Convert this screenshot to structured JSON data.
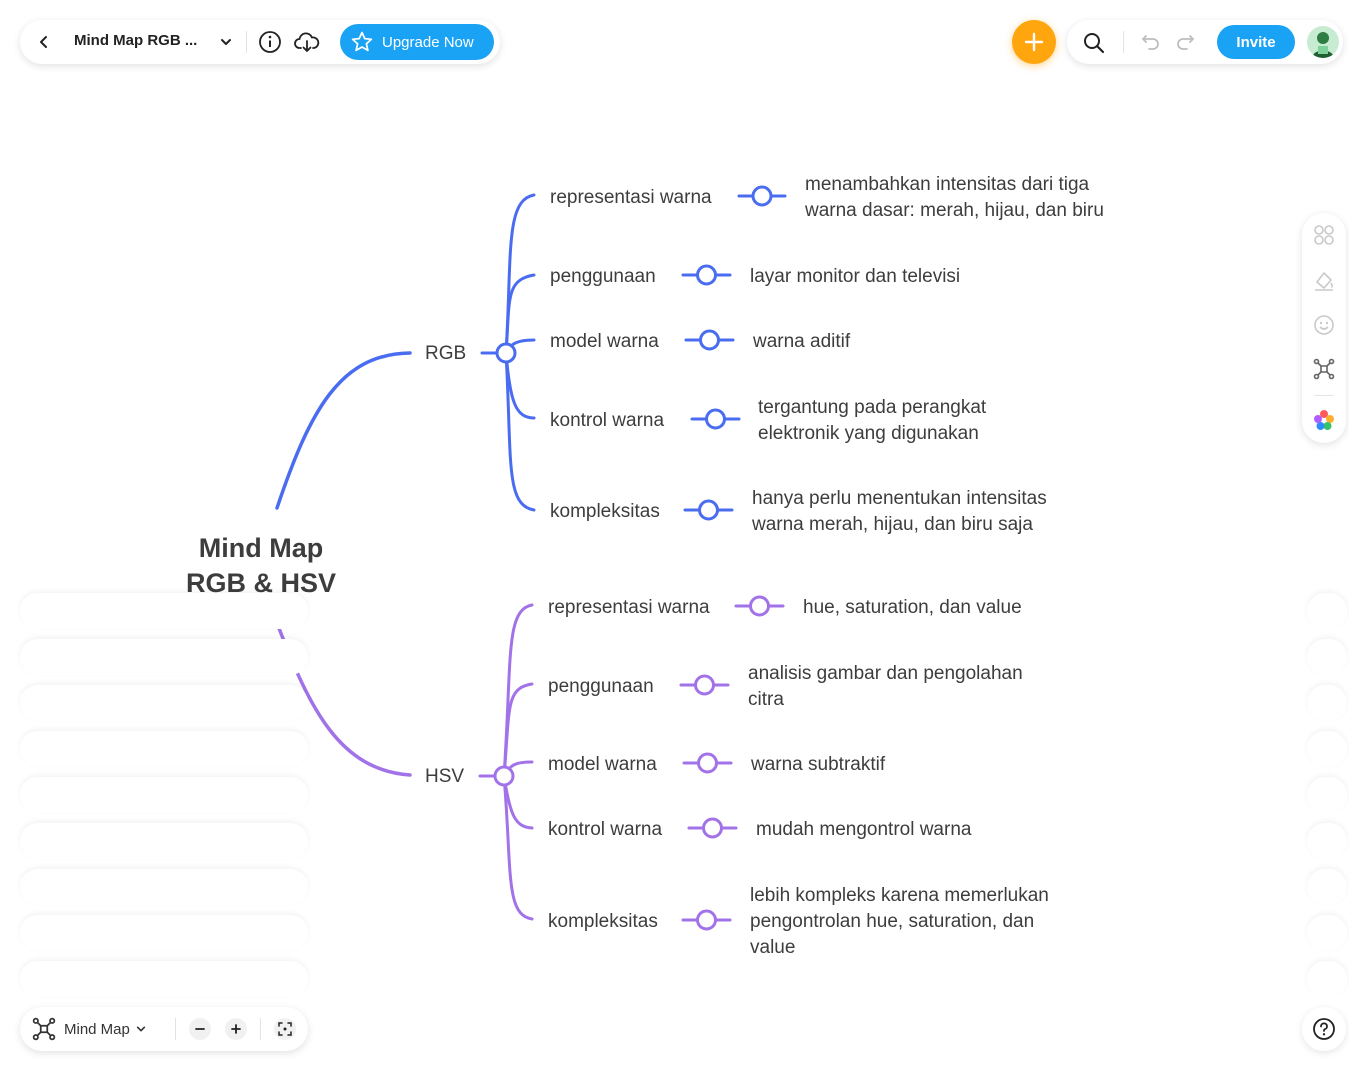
{
  "toolbar": {
    "doc_title": "Mind Map RGB ...",
    "upgrade_label": "Upgrade Now",
    "invite_label": "Invite"
  },
  "bottombar": {
    "view_label": "Mind Map"
  },
  "colors": {
    "rgb_branch": "#4a6cf0",
    "hsv_branch": "#a272e8",
    "accent": "#1aa3f5",
    "add_button": "#ffa50d"
  },
  "mindmap": {
    "root": {
      "line1": "Mind Map",
      "line2": "RGB & HSV"
    },
    "rgb": {
      "label": "RGB",
      "children": [
        {
          "label": "representasi warna",
          "detail": [
            "menambahkan intensitas dari tiga",
            "warna dasar: merah, hijau, dan biru"
          ]
        },
        {
          "label": "penggunaan",
          "detail": [
            "layar monitor dan televisi"
          ]
        },
        {
          "label": "model warna",
          "detail": [
            "warna aditif"
          ]
        },
        {
          "label": "kontrol warna",
          "detail": [
            "tergantung pada perangkat",
            "elektronik yang digunakan"
          ]
        },
        {
          "label": "kompleksitas",
          "detail": [
            "hanya perlu menentukan intensitas",
            "warna merah, hijau, dan biru saja"
          ]
        }
      ]
    },
    "hsv": {
      "label": "HSV",
      "children": [
        {
          "label": "representasi warna",
          "detail": [
            "hue, saturation, dan value"
          ]
        },
        {
          "label": "penggunaan",
          "detail": [
            "analisis gambar dan pengolahan",
            "citra"
          ]
        },
        {
          "label": "model warna",
          "detail": [
            "warna subtraktif"
          ]
        },
        {
          "label": "kontrol warna",
          "detail": [
            "mudah mengontrol warna"
          ]
        },
        {
          "label": "kompleksitas",
          "detail": [
            "lebih kompleks karena memerlukan",
            "pengontrolan hue, saturation, dan",
            "value"
          ]
        }
      ]
    }
  }
}
